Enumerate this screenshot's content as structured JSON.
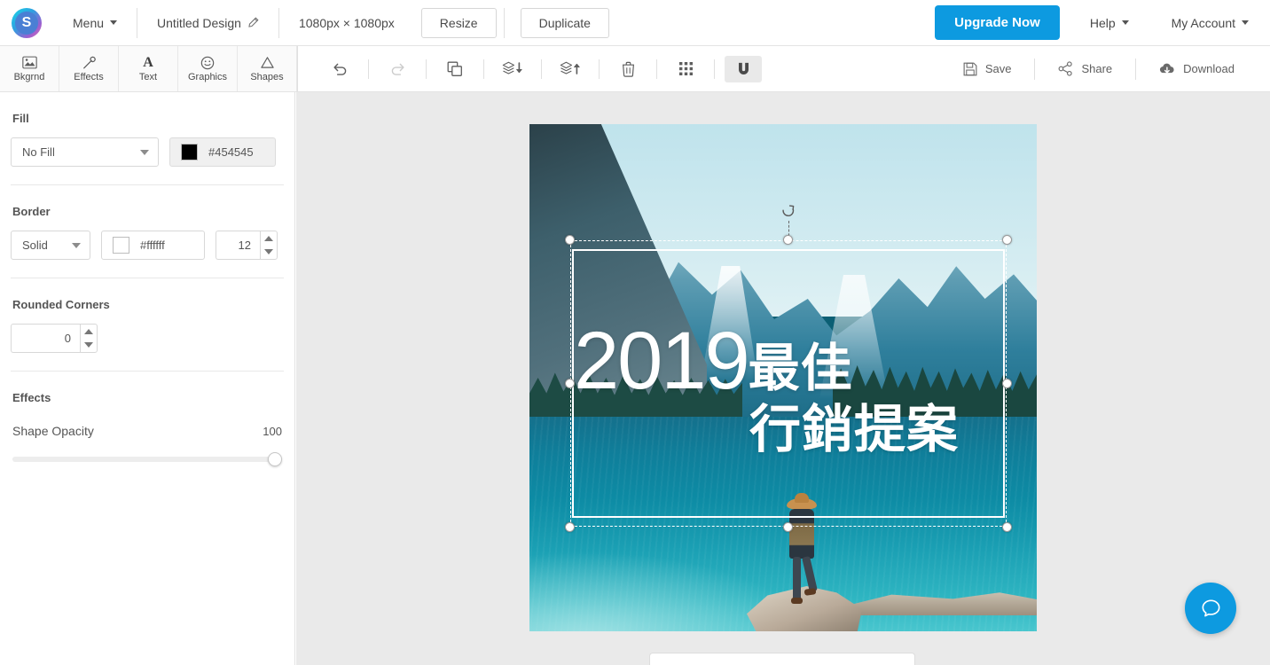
{
  "header": {
    "logo_letter": "S",
    "menu_label": "Menu",
    "design_title": "Untitled Design",
    "canvas_size": "1080px × 1080px",
    "resize_label": "Resize",
    "duplicate_label": "Duplicate",
    "upgrade_label": "Upgrade Now",
    "help_label": "Help",
    "account_label": "My Account"
  },
  "tool_tabs": [
    {
      "label": "Bkgrnd",
      "icon": "image-icon"
    },
    {
      "label": "Effects",
      "icon": "magic-wand-icon"
    },
    {
      "label": "Text",
      "icon": "text-icon"
    },
    {
      "label": "Graphics",
      "icon": "smiley-icon"
    },
    {
      "label": "Shapes",
      "icon": "triangle-icon"
    }
  ],
  "toolbar_actions": [
    {
      "name": "undo",
      "icon": "undo-icon",
      "disabled": false
    },
    {
      "name": "redo",
      "icon": "redo-icon",
      "disabled": true
    },
    {
      "name": "duplicate",
      "icon": "copy-icon",
      "disabled": false
    },
    {
      "name": "send-backward",
      "icon": "layers-down-icon",
      "disabled": false
    },
    {
      "name": "bring-forward",
      "icon": "layers-up-icon",
      "disabled": false
    },
    {
      "name": "delete",
      "icon": "trash-icon",
      "disabled": false
    },
    {
      "name": "grid",
      "icon": "grid-icon",
      "disabled": false
    },
    {
      "name": "snap",
      "icon": "magnet-icon",
      "disabled": false,
      "active": true
    }
  ],
  "toolbar_right": [
    {
      "label": "Save",
      "icon": "floppy-disk-icon"
    },
    {
      "label": "Share",
      "icon": "share-icon"
    },
    {
      "label": "Download",
      "icon": "cloud-download-icon"
    }
  ],
  "sidebar": {
    "fill": {
      "title": "Fill",
      "type_value": "No Fill",
      "color_value": "#454545",
      "swatch_color": "#000000"
    },
    "border": {
      "title": "Border",
      "style_value": "Solid",
      "color_value": "#ffffff",
      "swatch_color": "#ffffff",
      "width_value": "12"
    },
    "rounded_corners": {
      "title": "Rounded Corners",
      "value": "0"
    },
    "effects": {
      "title": "Effects",
      "opacity_label": "Shape Opacity",
      "opacity_value": "100",
      "opacity_percent": 100
    }
  },
  "canvas": {
    "design_year": "2019",
    "design_line1": "最佳",
    "design_line2": "行銷提案"
  },
  "colors": {
    "accent_blue": "#0d9ae0",
    "canvas_bg": "#eaeaea",
    "panel_bg": "#ffffff",
    "border_gray": "#e3e3e3",
    "text_gray": "#4a4a4a"
  }
}
